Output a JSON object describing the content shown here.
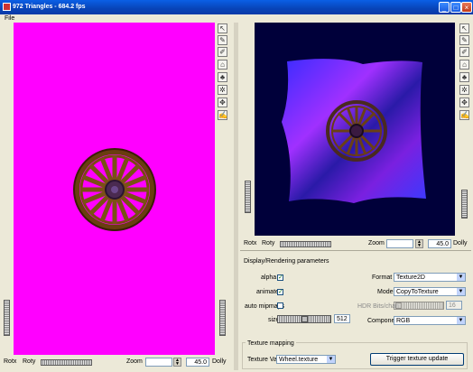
{
  "window": {
    "title": "972 Triangles - 684.2 fps",
    "minimize": "_",
    "maximize": "□",
    "close": "×"
  },
  "menu": {
    "file": "File"
  },
  "left_view": {
    "bottom": {
      "rotx": "Rotx",
      "roty": "Roty",
      "zoom": "Zoom",
      "value": "45.0",
      "dolly": "Dolly"
    },
    "bg_color": "#ff00ff"
  },
  "right_view": {
    "bottom": {
      "rotx": "Rotx",
      "roty": "Roty",
      "zoom": "Zoom",
      "value": "45.0",
      "dolly": "Dolly"
    },
    "bg_color": "#00003a"
  },
  "toolbar_icons": [
    "pointer-icon",
    "pen-icon",
    "brush-icon",
    "house-icon",
    "trees-icon",
    "mesh-icon",
    "move-icon",
    "paint-icon"
  ],
  "toolbar_glyphs": [
    "↖",
    "✎",
    "✐",
    "⌂",
    "♣",
    "✲",
    "✥",
    "✍"
  ],
  "params": {
    "header": "Display/Rendering parameters",
    "alpha_label": "alpha",
    "alpha_checked": true,
    "animate_label": "animate",
    "animate_checked": true,
    "auto_mipmaps_label": "auto mipmaps",
    "auto_mipmaps_checked": false,
    "size_label": "size",
    "size_value": "512",
    "format_label": "Format",
    "format_value": "Texture2D",
    "mode_label": "Mode",
    "mode_value": "CopyToTexture",
    "hdr_label": "HDR Bits/chan",
    "hdr_value": "16",
    "component_label": "Component",
    "component_value": "RGB"
  },
  "footer": {
    "group_label": "Texture mapping",
    "texture_label": "Texture Value",
    "texture_value": "Wheel.texture",
    "update_button": "Trigger texture update"
  }
}
